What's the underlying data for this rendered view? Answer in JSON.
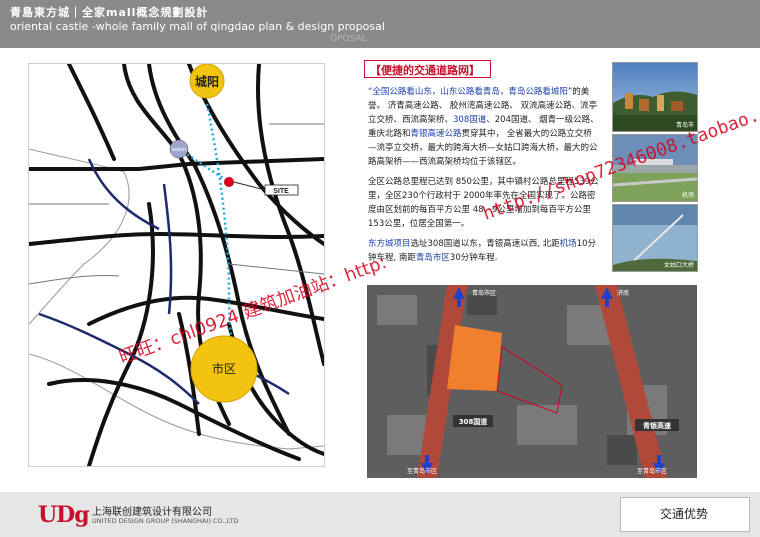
{
  "header": {
    "title_cn": "青島東方城｜全家mall概念規劃設計",
    "title_en": "oriental castle -whole family mall of qingdao plan & design proposal",
    "ghost_text": "OPOSAL"
  },
  "map": {
    "city_north": "城阳",
    "city_center": "市区",
    "airport": "airport",
    "site": "SITE"
  },
  "section_title": "【便捷的交通道路网】",
  "paragraph1": {
    "quote": "“全国公路看山东，山东公路看青岛，青岛公路看城阳",
    "rest_a": "”的美誉。  济青高速公路、 胶州湾高速公路、 双流高速公路、流亭立交桥、西流高架桥、",
    "hl_308": "308国道",
    "rest_b": "、204国道、 烟青一级公路、重庆北路和",
    "hl_qy": "青银高速公路",
    "rest_c": "贯穿其中， 全省最大的公路立交桥—流亭立交桥，最大的跨海大桥—女姑口跨海大桥，最大的公路高架桥——西流高架桥均位于该辖区。"
  },
  "paragraph2": "全区公路总里程已达到 850公里，其中镇村公路总里程539公里，全区230个行政村于 2000年率先在全国实现了。公路密度由区划前的每百平方公里 48．9公里增加到每百平方公里153公里，位居全国第一。",
  "paragraph3": {
    "hl_a": "东方城项目",
    "text_a": "选址308国道以东，青银高速以西, 北距",
    "hl_b": "机场",
    "text_b": "10分钟车程, 南距",
    "hl_c": "青岛市区",
    "text_c": "30分钟车程."
  },
  "photos": [
    {
      "caption": "青岛市"
    },
    {
      "caption": "机场"
    },
    {
      "caption": "女姑口大桥"
    }
  ],
  "aerial": {
    "road_label_308": "308国道",
    "road_label_qy": "青银高速",
    "arrow_label_left_top": "青岛市区",
    "arrow_label_right_top": "济南",
    "arrow_label_left_bottom": "至青岛市区",
    "arrow_label_right_bottom": "至青岛市区"
  },
  "watermarks": {
    "line1": "http://shop72346008.taobao.com/",
    "line2": "旺旺：chl0924   建筑加油站：http:"
  },
  "footer": {
    "logo": "UDg",
    "company_cn": "上海联创建筑设计有限公司",
    "company_en": "UNITED DESIGN GROUP (SHANGHAI) CO.,LTD",
    "page_title": "交通优势"
  },
  "colors": {
    "accent_red": "#c8102e",
    "highlight_blue": "#1a3ea6",
    "city_yellow": "#f2c40f",
    "site_orange": "#f07f2e",
    "road_brown": "#b0493a"
  }
}
